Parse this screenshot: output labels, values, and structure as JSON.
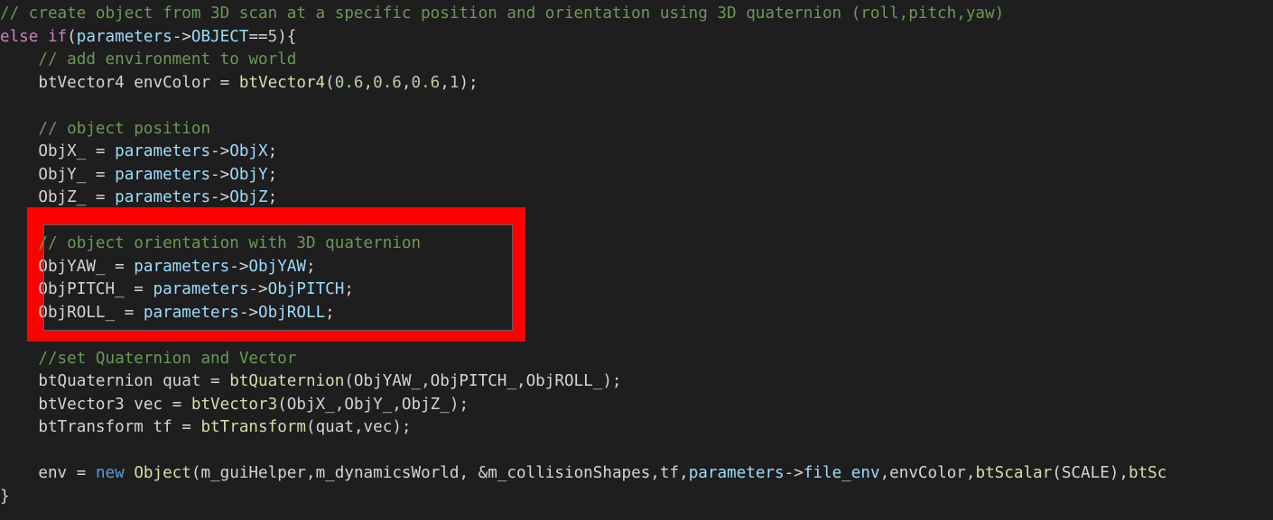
{
  "highlight": {
    "color": "#ff0000",
    "first_line": 10,
    "last_line": 13
  },
  "colors": {
    "background": "#1e1e1e",
    "comment": "#6a9955",
    "keyword": "#c586c0",
    "parameter": "#9cdcfe",
    "number": "#b5cea8",
    "function": "#dcdcaa",
    "plain": "#d4d4d4"
  },
  "lines": [
    [
      {
        "t": "// create object from 3D scan at a specific position and orientation using 3D quaternion (roll,pitch,yaw)",
        "c": "comment"
      }
    ],
    [
      {
        "t": "else if",
        "c": "keyword"
      },
      {
        "t": "(",
        "c": "plain"
      },
      {
        "t": "parameters",
        "c": "param"
      },
      {
        "t": "->",
        "c": "plain"
      },
      {
        "t": "OBJECT",
        "c": "param"
      },
      {
        "t": "==",
        "c": "plain"
      },
      {
        "t": "5",
        "c": "number"
      },
      {
        "t": "){",
        "c": "plain"
      }
    ],
    [
      {
        "t": "    ",
        "c": "plain"
      },
      {
        "t": "// add environment to world",
        "c": "comment"
      }
    ],
    [
      {
        "t": "    btVector4 envColor = ",
        "c": "plain"
      },
      {
        "t": "btVector4",
        "c": "func"
      },
      {
        "t": "(",
        "c": "plain"
      },
      {
        "t": "0.6",
        "c": "number"
      },
      {
        "t": ",",
        "c": "plain"
      },
      {
        "t": "0.6",
        "c": "number"
      },
      {
        "t": ",",
        "c": "plain"
      },
      {
        "t": "0.6",
        "c": "number"
      },
      {
        "t": ",",
        "c": "plain"
      },
      {
        "t": "1",
        "c": "number"
      },
      {
        "t": ");",
        "c": "plain"
      }
    ],
    [],
    [
      {
        "t": "    ",
        "c": "plain"
      },
      {
        "t": "// object position",
        "c": "comment"
      }
    ],
    [
      {
        "t": "    ObjX_ = ",
        "c": "plain"
      },
      {
        "t": "parameters",
        "c": "param"
      },
      {
        "t": "->",
        "c": "plain"
      },
      {
        "t": "ObjX",
        "c": "param"
      },
      {
        "t": ";",
        "c": "plain"
      }
    ],
    [
      {
        "t": "    ObjY_ = ",
        "c": "plain"
      },
      {
        "t": "parameters",
        "c": "param"
      },
      {
        "t": "->",
        "c": "plain"
      },
      {
        "t": "ObjY",
        "c": "param"
      },
      {
        "t": ";",
        "c": "plain"
      }
    ],
    [
      {
        "t": "    ObjZ_ = ",
        "c": "plain"
      },
      {
        "t": "parameters",
        "c": "param"
      },
      {
        "t": "->",
        "c": "plain"
      },
      {
        "t": "ObjZ",
        "c": "param"
      },
      {
        "t": ";",
        "c": "plain"
      }
    ],
    [],
    [
      {
        "t": "    ",
        "c": "plain"
      },
      {
        "t": "// object orientation with 3D quaternion",
        "c": "comment"
      }
    ],
    [
      {
        "t": "    ObjYAW_ = ",
        "c": "plain"
      },
      {
        "t": "parameters",
        "c": "param"
      },
      {
        "t": "->",
        "c": "plain"
      },
      {
        "t": "ObjYAW",
        "c": "param"
      },
      {
        "t": ";",
        "c": "plain"
      }
    ],
    [
      {
        "t": "    ObjPITCH_ = ",
        "c": "plain"
      },
      {
        "t": "parameters",
        "c": "param"
      },
      {
        "t": "->",
        "c": "plain"
      },
      {
        "t": "ObjPITCH",
        "c": "param"
      },
      {
        "t": ";",
        "c": "plain"
      }
    ],
    [
      {
        "t": "    ObjROLL_ = ",
        "c": "plain"
      },
      {
        "t": "parameters",
        "c": "param"
      },
      {
        "t": "->",
        "c": "plain"
      },
      {
        "t": "ObjROLL",
        "c": "param"
      },
      {
        "t": ";",
        "c": "plain"
      }
    ],
    [],
    [
      {
        "t": "    ",
        "c": "plain"
      },
      {
        "t": "//set Quaternion and Vector",
        "c": "comment"
      }
    ],
    [
      {
        "t": "    btQuaternion quat = ",
        "c": "plain"
      },
      {
        "t": "btQuaternion",
        "c": "func"
      },
      {
        "t": "(ObjYAW_,ObjPITCH_,ObjROLL_);",
        "c": "plain"
      }
    ],
    [
      {
        "t": "    btVector3 vec = ",
        "c": "plain"
      },
      {
        "t": "btVector3",
        "c": "func"
      },
      {
        "t": "(ObjX_,ObjY_,ObjZ_);",
        "c": "plain"
      }
    ],
    [
      {
        "t": "    btTransform tf = ",
        "c": "plain"
      },
      {
        "t": "btTransform",
        "c": "func"
      },
      {
        "t": "(quat,vec);",
        "c": "plain"
      }
    ],
    [],
    [
      {
        "t": "    env = ",
        "c": "plain"
      },
      {
        "t": "new",
        "c": "new"
      },
      {
        "t": " ",
        "c": "plain"
      },
      {
        "t": "Object",
        "c": "func"
      },
      {
        "t": "(m_guiHelper,m_dynamicsWorld, &m_collisionShapes,tf,",
        "c": "plain"
      },
      {
        "t": "parameters",
        "c": "param"
      },
      {
        "t": "->",
        "c": "plain"
      },
      {
        "t": "file_env",
        "c": "param"
      },
      {
        "t": ",envColor,",
        "c": "plain"
      },
      {
        "t": "btScalar",
        "c": "func"
      },
      {
        "t": "(SCALE),",
        "c": "plain"
      },
      {
        "t": "btSc",
        "c": "func"
      }
    ],
    [
      {
        "t": "}",
        "c": "plain"
      }
    ]
  ]
}
